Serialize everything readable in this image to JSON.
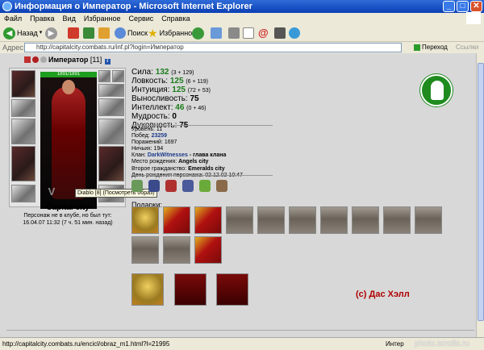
{
  "window": {
    "title": "Информация о Император - Microsoft Internet Explorer"
  },
  "menu": [
    "Файл",
    "Правка",
    "Вид",
    "Избранное",
    "Сервис",
    "Справка"
  ],
  "toolbar": {
    "back": "Назад",
    "search": "Поиск",
    "favorites": "Избранное"
  },
  "address": {
    "label": "Адрес:",
    "url": "http://capitalcity.combats.ru/inf.pl?login=Император",
    "go": "Переход",
    "links": "Ссылки"
  },
  "character": {
    "name": "Император",
    "level": "[11]",
    "hp": "1891/1891"
  },
  "tooltip": "Diablo [8] (Посмотреть образ)",
  "guild": {
    "city": "Capital city",
    "status_1": "Персонаж не в клубе, но был тут:",
    "status_2": "16.04.07 11:32 (7 ч. 51 мин. назад)"
  },
  "stats": [
    {
      "label": "Сила:",
      "value": "132",
      "extra": "(3 + 129)"
    },
    {
      "label": "Ловкость:",
      "value": "125",
      "extra": "(6 + 119)"
    },
    {
      "label": "Интуиция:",
      "value": "125",
      "extra": "(72 + 53)"
    },
    {
      "label": "Выносливость:",
      "value": "75",
      "extra": ""
    },
    {
      "label": "Интеллект:",
      "value": "46",
      "extra": "(0 + 46)"
    },
    {
      "label": "Мудрость:",
      "value": "0",
      "extra": ""
    },
    {
      "label": "Духовность:",
      "value": "75",
      "extra": ""
    }
  ],
  "info": {
    "level": "Уровень: 11",
    "wins_label": "Побед: ",
    "wins": "23259",
    "losses": "Поражений: 1697",
    "draws": "Ничьих: 194",
    "clan_label": "Клан: ",
    "clan": "DarkWitnesses",
    "clan_role": " - глава клана",
    "birth_label": "Место рождения: ",
    "birth": "Angels city",
    "cit_label": "Второе гражданство: ",
    "cit": "Emeralds city",
    "bday": "День рождения персонажа: 02.12.02 10:47"
  },
  "gifts_label": "Подарки:",
  "credit": "(c) Дас Хэлл",
  "status": {
    "url": "http://capitalcity.combats.ru/encicl/obraz_m1.html?l=21995",
    "zone": "Интер",
    "watermark": "photo.scrolls.ru"
  }
}
